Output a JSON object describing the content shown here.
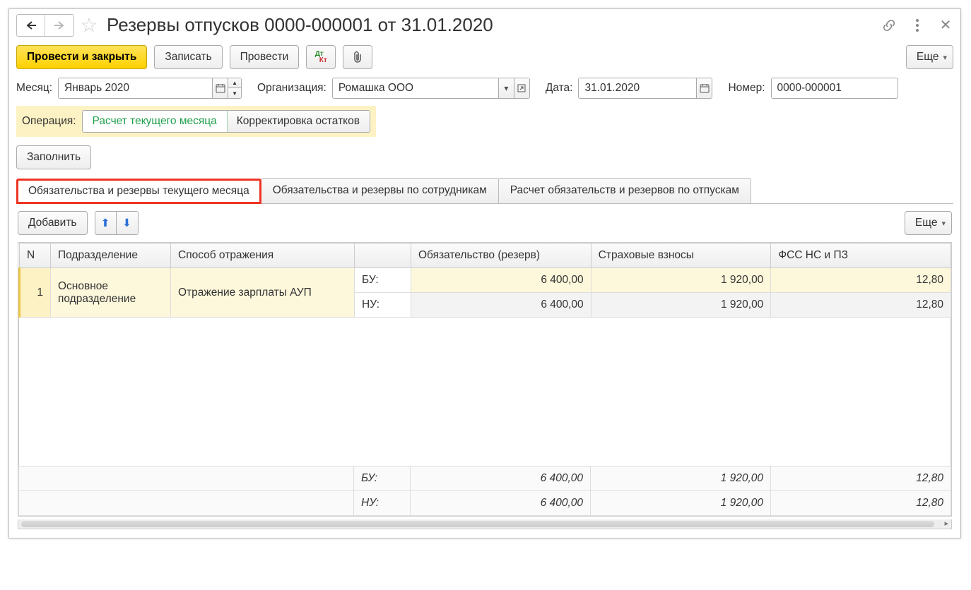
{
  "title": "Резервы отпусков 0000-000001 от 31.01.2020",
  "toolbar": {
    "post_close": "Провести и закрыть",
    "write": "Записать",
    "post": "Провести",
    "more": "Еще"
  },
  "form": {
    "month_label": "Месяц:",
    "month_value": "Январь 2020",
    "org_label": "Организация:",
    "org_value": "Ромашка ООО",
    "date_label": "Дата:",
    "date_value": "31.01.2020",
    "number_label": "Номер:",
    "number_value": "0000-000001"
  },
  "operation": {
    "label": "Операция:",
    "tab1": "Расчет текущего месяца",
    "tab2": "Корректировка остатков"
  },
  "fill_button": "Заполнить",
  "main_tabs": {
    "t1": "Обязательства и резервы текущего месяца",
    "t2": "Обязательства и резервы по сотрудникам",
    "t3": "Расчет обязательств и резервов по отпускам"
  },
  "tbl_toolbar": {
    "add": "Добавить",
    "more": "Еще"
  },
  "table": {
    "headers": {
      "n": "N",
      "dept": "Подразделение",
      "method": "Способ отражения",
      "type": "",
      "obligation": "Обязательство (резерв)",
      "contrib": "Страховые взносы",
      "fss": "ФСС НС и ПЗ"
    },
    "rows": [
      {
        "n": "1",
        "dept": "Основное подразделение",
        "method": "Отражение зарплаты АУП",
        "bu_label": "БУ:",
        "nu_label": "НУ:",
        "bu": {
          "obligation": "6 400,00",
          "contrib": "1 920,00",
          "fss": "12,80"
        },
        "nu": {
          "obligation": "6 400,00",
          "contrib": "1 920,00",
          "fss": "12,80"
        }
      }
    ],
    "footer": {
      "bu_label": "БУ:",
      "nu_label": "НУ:",
      "bu": {
        "obligation": "6 400,00",
        "contrib": "1 920,00",
        "fss": "12,80"
      },
      "nu": {
        "obligation": "6 400,00",
        "contrib": "1 920,00",
        "fss": "12,80"
      }
    }
  }
}
